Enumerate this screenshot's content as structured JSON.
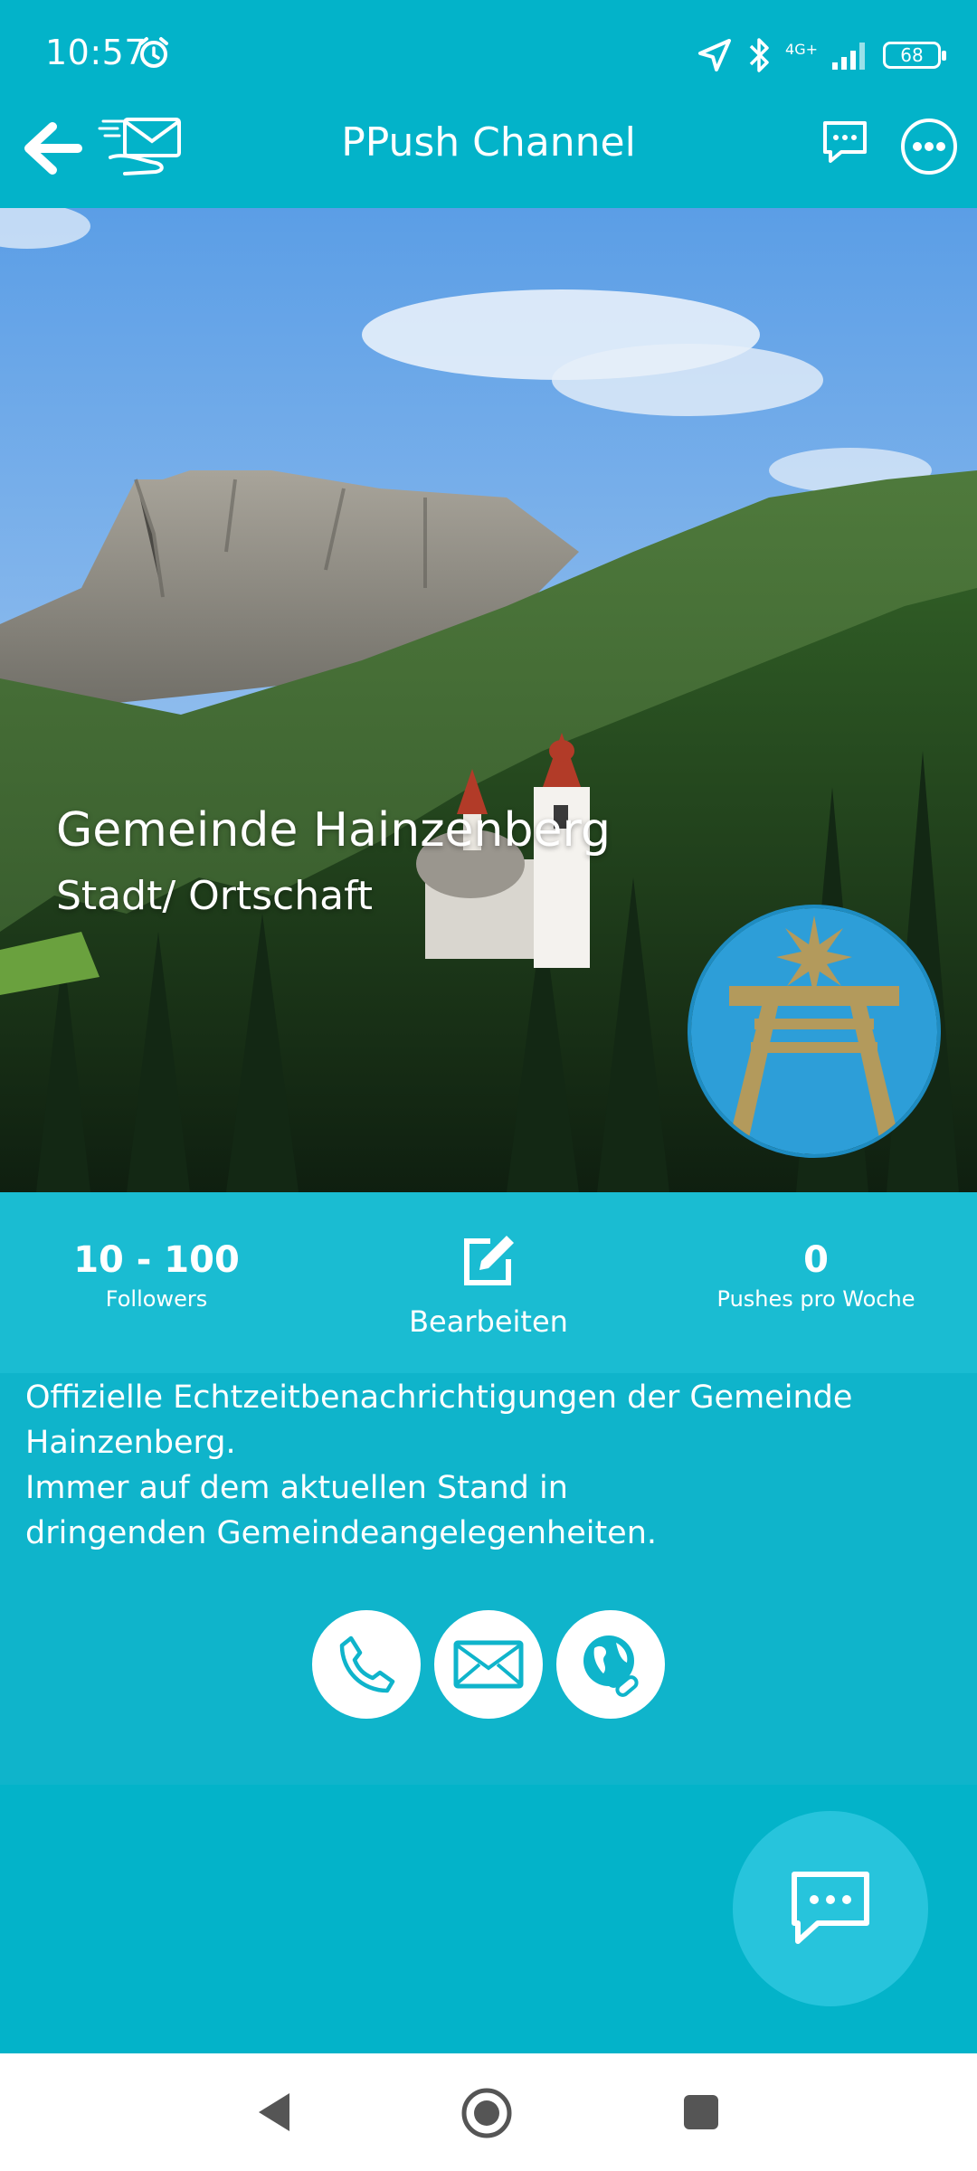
{
  "status_bar": {
    "time": "10:57",
    "network": "4G+",
    "battery": "68"
  },
  "header": {
    "title": "PPush Channel"
  },
  "channel": {
    "name": "Gemeinde Hainzenberg",
    "category": "Stadt/ Ortschaft"
  },
  "stats": {
    "followers_value": "10 - 100",
    "followers_label": "Followers",
    "edit_label": "Bearbeiten",
    "pushes_value": "0",
    "pushes_label": "Pushes pro Woche"
  },
  "description": {
    "line1": "Offizielle Echtzeitbenachrichtigungen der Gemeinde Hainzenberg.",
    "line2": "Immer auf dem aktuellen Stand in dringenden Gemeindeangelegenheiten."
  },
  "colors": {
    "primary": "#03b3c9",
    "stats_bg": "#1abcd2",
    "fab": "#27c4dc",
    "avatar_bg": "#2d9ed8",
    "avatar_symbol": "#b39a5c"
  },
  "icons": [
    "back-arrow-icon",
    "mail-logo-icon",
    "chat-icon",
    "more-icon",
    "edit-icon",
    "phone-icon",
    "email-icon",
    "web-icon"
  ]
}
